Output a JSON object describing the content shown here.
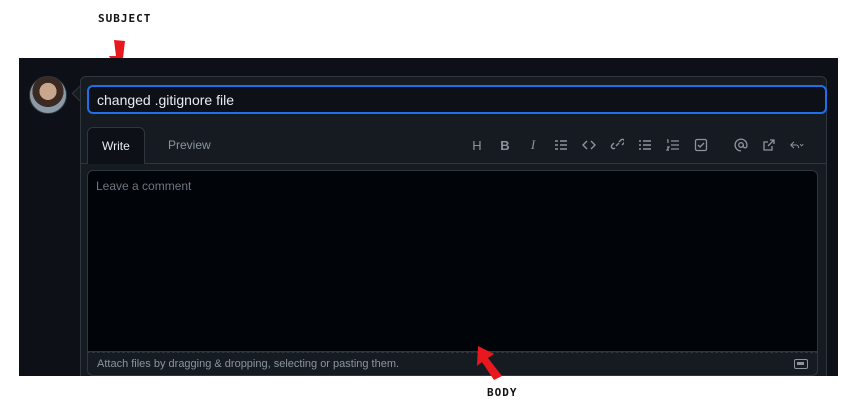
{
  "annotations": {
    "subject": "SUBJECT",
    "body": "BODY"
  },
  "colors": {
    "annotation_arrow": "#e8181e",
    "focus_border": "#1f6feb",
    "background": "#0d1117"
  },
  "issue": {
    "title_value": "changed .gitignore file"
  },
  "tabs": [
    {
      "label": "Write",
      "active": true
    },
    {
      "label": "Preview",
      "active": false
    }
  ],
  "toolbar": {
    "icons": [
      "heading-icon",
      "bold-icon",
      "italic-icon",
      "quote-icon",
      "code-icon",
      "link-icon",
      "bulleted-list-icon",
      "numbered-list-icon",
      "task-list-icon",
      "mention-icon",
      "reference-icon",
      "saved-replies-icon"
    ],
    "heading": "H",
    "bold": "B",
    "italic": "I"
  },
  "comment": {
    "placeholder": "Leave a comment",
    "value": ""
  },
  "attach": {
    "text": "Attach files by dragging & dropping, selecting or pasting them."
  }
}
